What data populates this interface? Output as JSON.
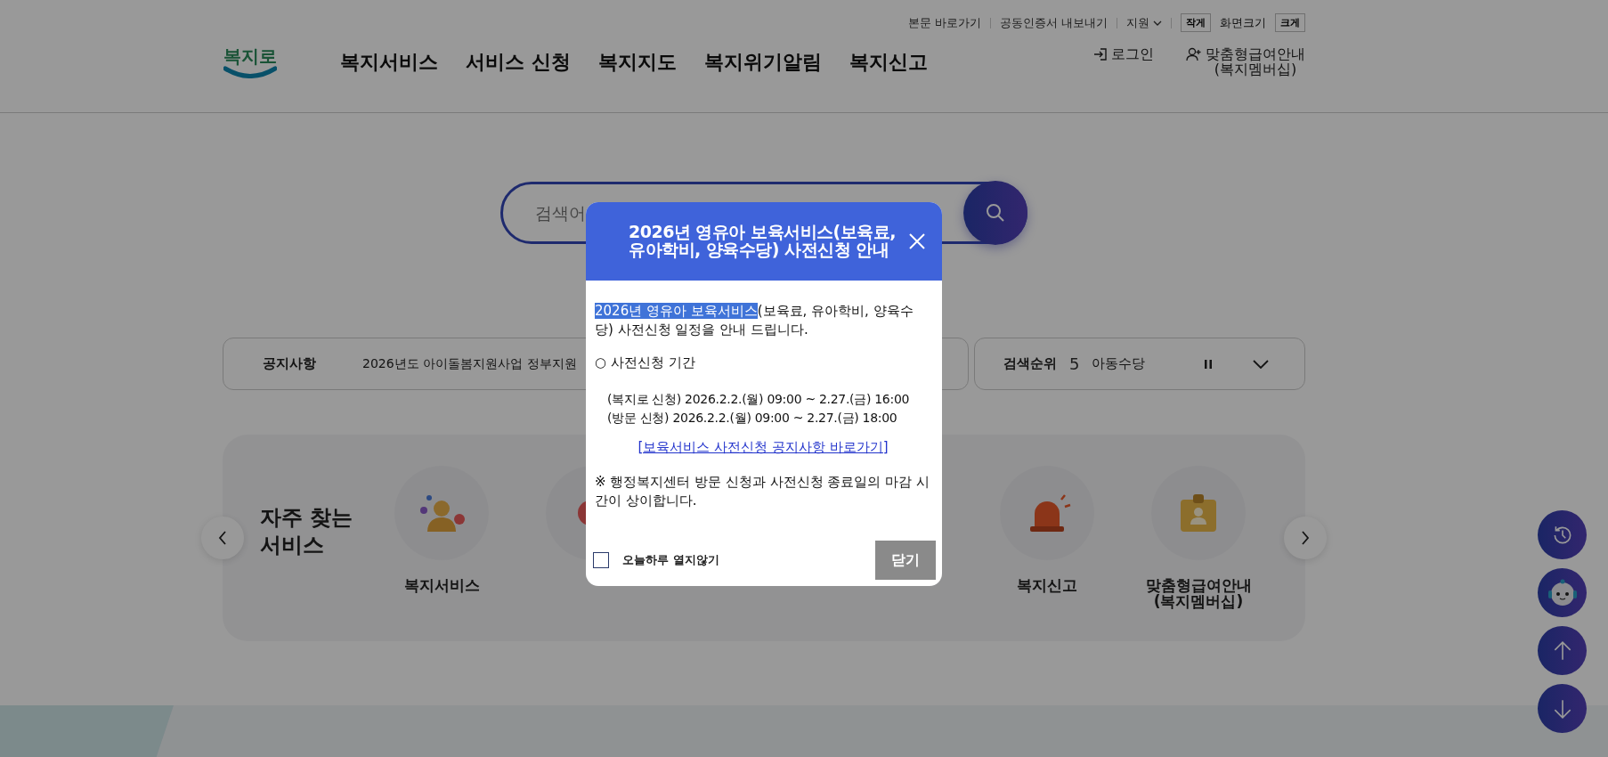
{
  "top_links": [
    {
      "label": "본문 바로가기",
      "kind": "link"
    },
    {
      "label": "공동인증서 내보내기",
      "kind": "link"
    },
    {
      "label": "지원",
      "kind": "dropdown"
    }
  ],
  "font_size": {
    "small": "작게",
    "label": "화면크기",
    "large": "크게"
  },
  "logo": "복지로",
  "nav": [
    "복지서비스",
    "서비스 신청",
    "복지지도",
    "복지위기알림",
    "복지신고"
  ],
  "user_links": [
    {
      "kind": "login",
      "lines": [
        "로그인"
      ]
    },
    {
      "kind": "member",
      "lines": [
        "맞춤형급여안내",
        "(복지멤버십)"
      ]
    }
  ],
  "search": {
    "placeholder": "검색어"
  },
  "notice": {
    "label": "공지사항",
    "text": "2026년도 아이돌봄지원사업 정부지원"
  },
  "ranking": {
    "label": "검색순위",
    "rank": "5",
    "term": "아동수당"
  },
  "quick": {
    "title": [
      "자주 찾는",
      "서비스"
    ],
    "items": [
      {
        "kind": "people",
        "lines": [
          "복지서비스"
        ]
      },
      {
        "kind": "ball"
      },
      {
        "kind": "none"
      },
      {
        "kind": "none"
      },
      {
        "kind": "siren",
        "lines": [
          "복지신고"
        ]
      },
      {
        "kind": "badge",
        "lines": [
          "맞춤형급여안내",
          "(복지멤버십)"
        ]
      }
    ]
  },
  "float_buttons": [
    {
      "kind": "history"
    },
    {
      "kind": "chatbot"
    },
    {
      "kind": "up"
    },
    {
      "kind": "down"
    }
  ],
  "modal": {
    "title": "2026년 영유아 보육서비스(보육료, 유아학비, 양육수당) 사전신청 안내",
    "intro_selected": "2026년 영유아 보육서비스",
    "intro_rest": "(보육료, 유아학비, 양육수당) 사전신청 일정을 안내 드립니다.",
    "section": "○ 사전신청 기간",
    "schedules": [
      "(복지로 신청) 2026.2.2.(월) 09:00 ~ 2.27.(금) 16:00",
      "(방문 신청) 2026.2.2.(월) 09:00 ~ 2.27.(금) 18:00"
    ],
    "link": "[보육서비스 사전신청 공지사항 바로가기]",
    "note": "※ 행정복지센터 방문 신청과 사전신청 종료일의 마감 시간이 상이합니다.",
    "dont_show": {
      "label": "오늘하루 열지않기",
      "checked": false
    },
    "close_button": "닫기"
  }
}
